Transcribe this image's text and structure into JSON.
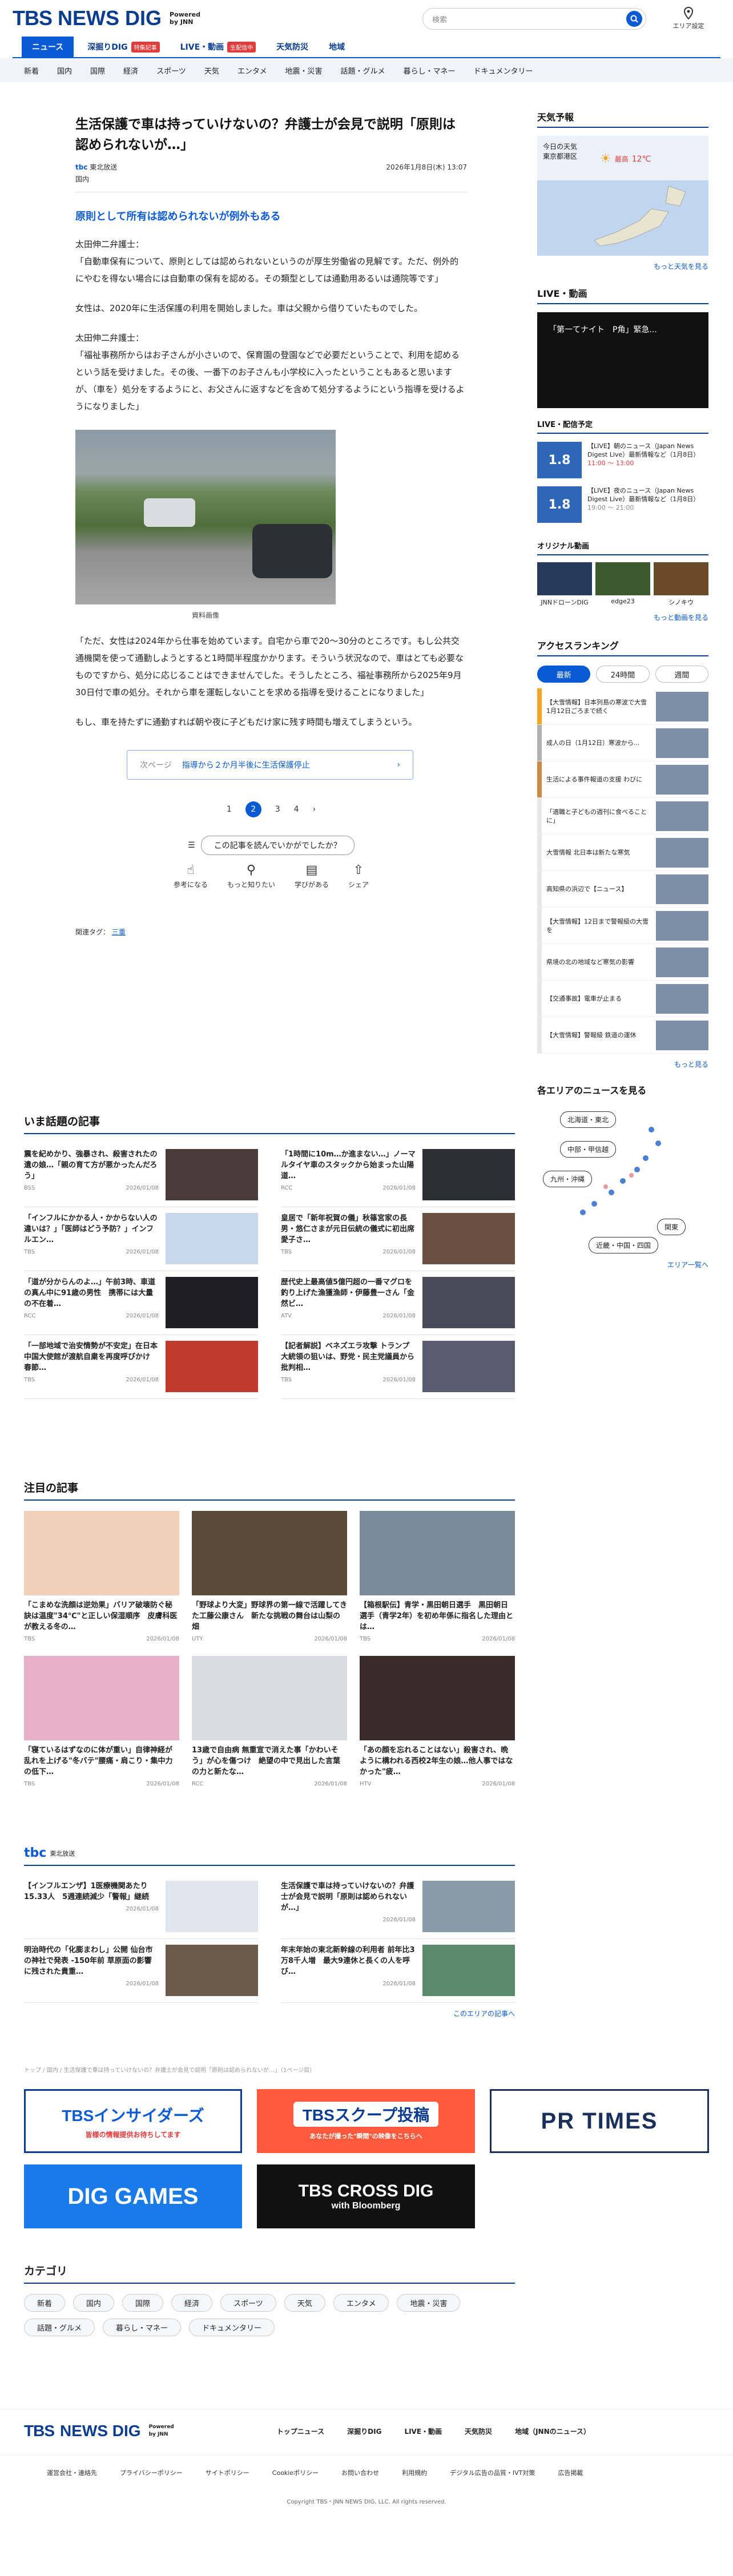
{
  "header": {
    "logo1": "TBS",
    "logo2": "NEWS DIG",
    "powered1": "Powered",
    "powered2": "by JNN",
    "search_placeholder": "検索",
    "area_label": "エリア設定"
  },
  "nav": [
    {
      "label": "ニュース",
      "active": true
    },
    {
      "label": "深掘りDIG",
      "badge": "特集記事"
    },
    {
      "label": "LIVE・動画",
      "badge": "生配信中"
    },
    {
      "label": "天気防災"
    },
    {
      "label": "地域"
    }
  ],
  "categories": [
    "新着",
    "国内",
    "国際",
    "経済",
    "スポーツ",
    "天気",
    "エンタメ",
    "地震・災害",
    "話題・グルメ",
    "暮らし・マネー",
    "ドキュメンタリー"
  ],
  "article": {
    "title": "生活保護で車は持っていけないの？弁護士が会見で説明「原則は認められないが…」",
    "source": "東北放送",
    "date": "2026年1月8日(木) 13:07",
    "category": "国内",
    "lead": "原則として所有は認められないが例外もある",
    "paras": [
      "太田伸二弁護士：\n「自動車保有について、原則としては認められないというのが厚生労働省の見解です。ただ、例外的にやむを得ない場合には自動車の保有を認める。その類型としては通勤用あるいは通院等です」",
      "女性は、2020年に生活保護の利用を開始しました。車は父親から借りていたものでした。",
      "太田伸二弁護士：\n「福祉事務所からはお子さんが小さいので、保育園の登園などで必要だということで、利用を認めるという話を受けました。その後、一番下のお子さんも小学校に入ったということもあると思いますが、（車を）処分をするようにと、お父さんに返すなどを含めて処分するようにという指導を受けるようになりました」"
    ],
    "caption": "資料画像",
    "paras2": [
      "「ただ、女性は2024年から仕事を始めています。自宅から車で20～30分のところです。もし公共交通機関を使って通勤しようとすると1時間半程度かかります。そういう状況なので、車はとても必要なものですから、処分に応じることはできませんでした。そうしたところ、福祉事務所から2025年9月30日付で車の処分。それから車を運転しないことを求める指導を受けることになりました」",
      "もし、車を持たずに通勤すれば朝や夜に子どもだけ家に残す時間も増えてしまうという。"
    ],
    "next_label": "次ページ",
    "next_title": "指導から２か月半後に生活保護停止",
    "pages": [
      "1",
      "2",
      "3",
      "4"
    ],
    "current_page": "2",
    "question": "この記事を読んでいかがでしたか？",
    "reactions": [
      "参考になる",
      "もっと知りたい",
      "学びがある",
      "シェア"
    ],
    "tags_label": "関連タグ：",
    "tag": "三重"
  },
  "sidebar": {
    "weather_title": "天気予報",
    "weather_day": "今日の天気",
    "weather_city": "東京都港区",
    "weather_hi_label": "最高",
    "weather_hi": "12℃",
    "weather_more": "もっと天気を見る",
    "live_title": "LIVE・動画",
    "live_video_title": "「第一てナイト　P角」緊急...",
    "schedule_title": "LIVE・配信予定",
    "schedule": [
      {
        "tag": "LIVE",
        "thumb": "1.8",
        "text": "【LIVE】朝のニュース（Japan News Digest Live）最新情報など（1月8日）",
        "time": "11:00 ～ 13:00"
      },
      {
        "tag": "",
        "thumb": "1.8",
        "text": "【LIVE】夜のニュース（Japan News Digest Live）最新情報など（1月8日）",
        "time": "19:00 ～ 21:00"
      }
    ],
    "orig_title": "オリジナル動画",
    "orig": [
      "JNNドローンDIG",
      "edge23",
      "シノキウ"
    ],
    "orig_more": "もっと動画を見る",
    "rank_title": "アクセスランキング",
    "rank_tabs": [
      "最新",
      "24時間",
      "週間"
    ],
    "ranks": [
      "【大雪情報】日本列島の寒波で大雪 1月12日ごろまで続く",
      "成人の日（1月12日）寒波から...",
      "生活による事件報道の支援 わびに",
      "「適職と子どもの週刊に食べることに」",
      "大雪情報 北日本は新たな寒気",
      "高知県の浜辺で【ニュース】",
      "【大雪情報】12日まで警報級の大雪を",
      "県境の北の地域など寒気の影響",
      "【交通事故】電車が止まる",
      "【大雪情報】警報級 鉄道の運休"
    ],
    "rank_more": "もっと見る",
    "area_title": "各エリアのニュースを見る",
    "areas": [
      "北海道・東北",
      "中部・甲信越",
      "九州・沖縄",
      "関東",
      "近畿・中国・四国"
    ],
    "area_more": "エリア一覧へ"
  },
  "topics": {
    "title": "いま話題の記事",
    "items": [
      {
        "t": "震を紀めかり、強暴され、殺害されたの遺の娘…「親の育て方が悪かったんだろう」",
        "s": "BSS",
        "d": "2026/01/08"
      },
      {
        "t": "「1時間に10m…か進まない…」ノーマルタイヤ車のスタックから始まった山陽道…",
        "s": "RCC",
        "d": "2026/01/08"
      },
      {
        "t": "「インフルにかかる人・かからない人の違いは？」「医師はどう予防？」インフルエン…",
        "s": "TBS",
        "d": "2026/01/08"
      },
      {
        "t": "皇居で「新年祝賀の儀」秋篠宮家の長男・悠仁さまが元日伝統の儀式に初出席 愛子さ…",
        "s": "TBS",
        "d": "2026/01/08"
      },
      {
        "t": "「道が分からんのよ…」午前3時、車道の真ん中に91歳の男性　携帯には大量の不在着…",
        "s": "RCC",
        "d": "2026/01/08"
      },
      {
        "t": "歴代史上最高値5億円超の一番マグロを釣り上げた漁獲漁師・伊藤豊一さん「金然ビ…",
        "s": "ATV",
        "d": "2026/01/08"
      },
      {
        "t": "「一部地域で治安情勢が不安定」在日本中国大使館が渡航自粛を再度呼びかけ　春節…",
        "s": "TBS",
        "d": "2026/01/08"
      },
      {
        "t": "【記者解説】ベネズエラ攻撃 トランプ大統領の狙いは、野党・民主党議員から批判相…",
        "s": "TBS",
        "d": "2026/01/08"
      }
    ]
  },
  "featured": {
    "title": "注目の記事",
    "items": [
      {
        "t": "「こまめな洗顔は逆効果」バリア破壊防ぐ秘訣は温度\"34℃\"と正しい保湿順序　皮膚科医が教える冬の…",
        "s": "TBS",
        "d": "2026/01/08"
      },
      {
        "t": "「野球より大変」野球界の第一線で活躍してきた工藤公康さん　新たな挑戦の舞台は山梨の畑",
        "s": "UTY",
        "d": "2026/01/08"
      },
      {
        "t": "【箱根駅伝】青学・黒田朝日選手　黒田朝日選手（青学2年）を初め年係に指名した理由とは…",
        "s": "TBS",
        "d": "2026/01/08"
      },
      {
        "t": "「寝ているはずなのに体が重い」自律神経が乱れを上げる\"冬バテ\"腰痛・肩こり・集中力の低下…",
        "s": "TBS",
        "d": "2026/01/08"
      },
      {
        "t": "13歳で自由病 無重宣で消えた事「かわいそう」が心を傷つけ　絶望の中で見出した言葉の力と新たな…",
        "s": "RCC",
        "d": "2026/01/08"
      },
      {
        "t": "「あの顔を忘れることはない」殺害され、晩ように構われる西校2年生の娘…他人事ではなかった\"疲…",
        "s": "HTV",
        "d": "2026/01/08"
      }
    ]
  },
  "local": {
    "station": "東北放送",
    "items": [
      {
        "t": "【インフルエンザ】1医療機関あたり15.33人　5週連続減少「警報」継続",
        "d": "2026/01/08"
      },
      {
        "t": "生活保護で車は持っていけないの？弁護士が会見で説明「原則は認められないが…」",
        "d": "2026/01/08"
      },
      {
        "t": "明治時代の「化膨まわし」公開 仙台市の神社で発表 -150年前 草原面の影響に残された貴重…",
        "d": "2026/01/08"
      },
      {
        "t": "年末年始の東北新幹線の利用者 前年比3万8千人増　最大9連休と長くの人を呼び…",
        "d": "2026/01/08"
      }
    ],
    "more": "このエリアの記事へ"
  },
  "breadcrumb": "トップ / 国内 / 生活保護で車は持っていけないの？弁護士が会見で説明「原則は認められないが…」（1ページ目）",
  "banners": [
    "TBSインサイダーズ",
    "皆様の情報提供お待ちしてます",
    "TBSスクープ投稿",
    "あなたが撮った\"瞬間\"の映像をこちらへ",
    "PR TIMES",
    "DIG GAMES",
    "TBS CROSS DIG",
    "with Bloomberg"
  ],
  "category_section": {
    "title": "カテゴリ",
    "items": [
      "新着",
      "国内",
      "国際",
      "経済",
      "スポーツ",
      "天気",
      "エンタメ",
      "地震・災害",
      "話題・グルメ",
      "暮らし・マネー",
      "ドキュメンタリー"
    ]
  },
  "footer": {
    "main_links": [
      "トップニュース",
      "深掘りDIG",
      "LIVE・動画",
      "天気防災",
      "地域（JNNのニュース）"
    ],
    "sub_links": [
      "運営会社・連絡先",
      "プライバシーポリシー",
      "サイトポリシー",
      "Cookieポリシー",
      "お問い合わせ",
      "利用規約",
      "デジタル広告の品質・IVT対策",
      "広告掲載"
    ],
    "copyright": "Copyright TBS・JNN NEWS DIG, LLC. All rights reserved."
  },
  "colors": {
    "brand": "#0a3d8f",
    "accent": "#0a5bd3",
    "alert": "#e23b3b"
  }
}
